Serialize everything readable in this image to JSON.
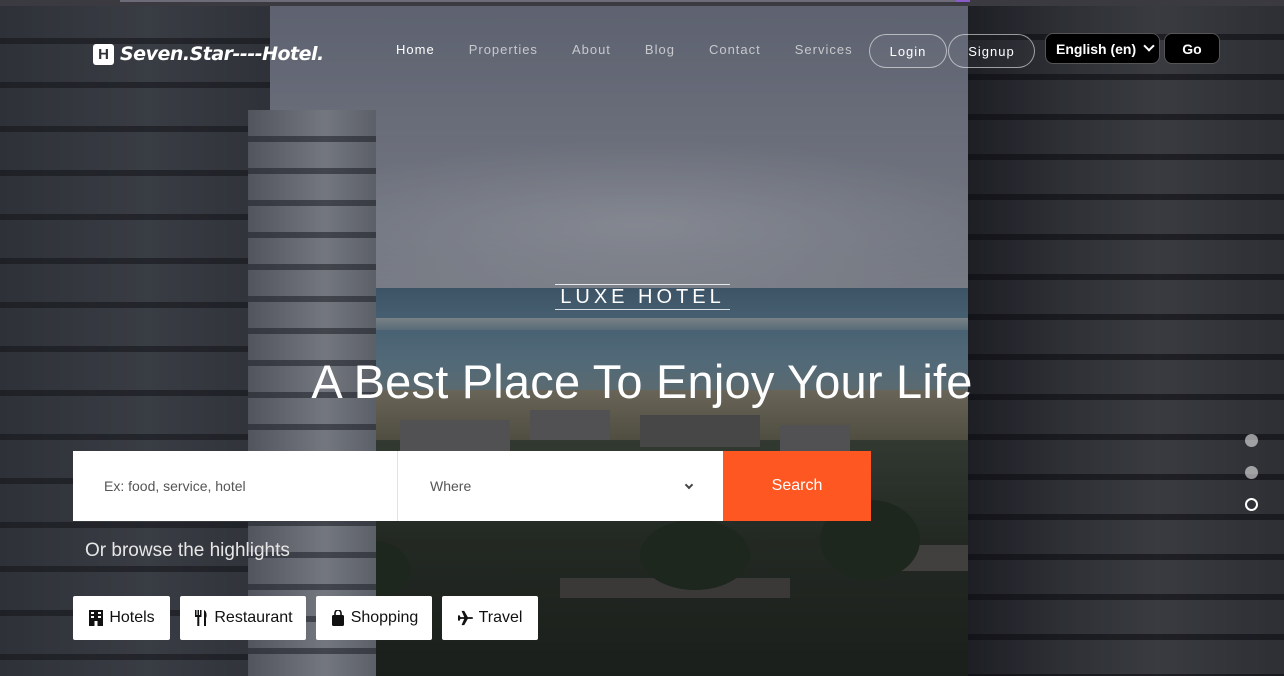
{
  "brand": {
    "icon_letter": "H",
    "name": "Seven.Star----Hotel."
  },
  "nav": {
    "items": [
      "Home",
      "Properties",
      "About",
      "Blog",
      "Contact",
      "Services"
    ],
    "active": "Home"
  },
  "auth": {
    "login_label": "Login",
    "signup_label": "Signup"
  },
  "language": {
    "selected": "English (en)",
    "go_label": "Go"
  },
  "hero": {
    "eyebrow": "LUXE HOTEL",
    "headline": "A Best Place To Enjoy Your Life"
  },
  "search": {
    "placeholder": "Ex: food, service, hotel",
    "where_label": "Where",
    "button_label": "Search"
  },
  "browse": {
    "label": "Or browse the highlights",
    "chips": [
      {
        "label": "Hotels",
        "icon": "building-icon"
      },
      {
        "label": "Restaurant",
        "icon": "utensils-icon"
      },
      {
        "label": "Shopping",
        "icon": "shopping-bag-icon"
      },
      {
        "label": "Travel",
        "icon": "airplane-icon"
      }
    ]
  },
  "carousel": {
    "slide_count": 3,
    "active_index": 2
  },
  "colors": {
    "accent": "#ff5722",
    "chip_bg": "#ffffff",
    "lang_bg": "#000000"
  }
}
